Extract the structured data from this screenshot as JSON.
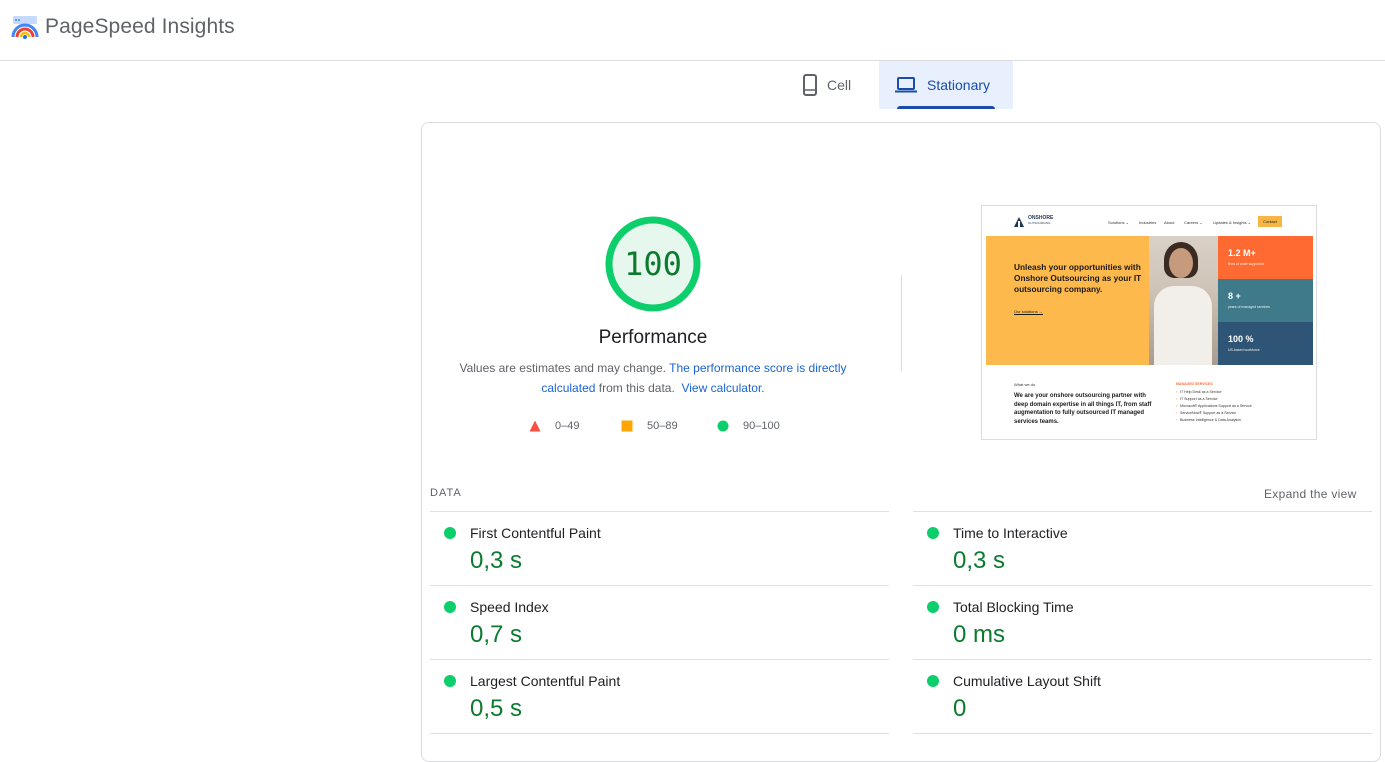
{
  "header": {
    "app_title": "PageSpeed Insights",
    "logo_icon": "pagespeed-logo-icon"
  },
  "tabs": [
    {
      "label": "Cell",
      "icon": "smartphone-icon",
      "selected": false
    },
    {
      "label": "Stationary",
      "icon": "laptop-icon",
      "selected": true
    }
  ],
  "performance": {
    "score": "100",
    "score_fraction": 1.0,
    "title": "Performance",
    "description_prefix": "Values are estimates and may change.",
    "description_link": "The performance score is directly calculated",
    "description_mid": "from this data.",
    "calculator_link": "View calculator.",
    "colors": {
      "pass": "#0cce6b",
      "average": "#ffa400",
      "fail": "#ff4e42",
      "pass_text": "#0c7a2f"
    }
  },
  "legend": [
    {
      "range": "0–49",
      "icon": "triangle-icon"
    },
    {
      "range": "50–89",
      "icon": "square-icon"
    },
    {
      "range": "90–100",
      "icon": "circle-icon"
    }
  ],
  "screenshot": {
    "logo_text_1": "ONSHORE",
    "logo_text_2": "OUTSOURCING",
    "nav": [
      "Solutions ⌄",
      "Industries",
      "About",
      "Careers ⌄",
      "Updates & Insights ⌄"
    ],
    "contact": "Contact",
    "hero_title": "Unleash your opportunities with Onshore Outsourcing as your IT outsourcing company.",
    "hero_link": "Our solutions →",
    "stats": [
      {
        "num": "1.2 M+",
        "sub": "lines of code supported"
      },
      {
        "num": "8 +",
        "sub": "years of managed services"
      },
      {
        "num": "100 %",
        "sub": "US-based workforce"
      }
    ],
    "what_we_do": "What we do",
    "body_text": "We are your onshore outsourcing partner with deep domain expertise in all things IT, from staff augmentation to fully outsourced IT managed services teams.",
    "side_heading": "MANAGED SERVICES",
    "side_items": [
      "IT Help Desk as a Service",
      "IT Support as a Service",
      "Microsoft® Applications Support as a Service",
      "ServiceNow® Support as a Service",
      "Business Intelligence & Data Analytics"
    ]
  },
  "data_section": {
    "label": "DATA",
    "expand_label": "Expand the view"
  },
  "metrics": [
    {
      "name": "First Contentful Paint",
      "value": "0,3 s"
    },
    {
      "name": "Time to Interactive",
      "value": "0,3 s"
    },
    {
      "name": "Speed Index",
      "value": "0,7 s"
    },
    {
      "name": "Total Blocking Time",
      "value": "0 ms"
    },
    {
      "name": "Largest Contentful Paint",
      "value": "0,5 s"
    },
    {
      "name": "Cumulative Layout Shift",
      "value": "0"
    }
  ]
}
